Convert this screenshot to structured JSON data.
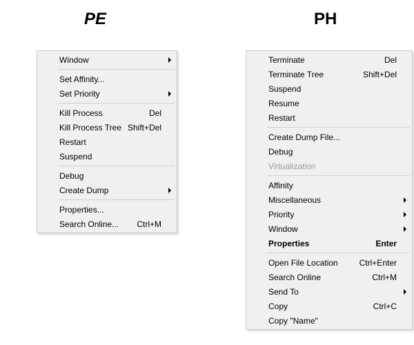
{
  "headings": {
    "pe": "PE",
    "ph": "PH"
  },
  "pe_menu": {
    "groups": [
      [
        {
          "label": "Window",
          "submenu": true
        }
      ],
      [
        {
          "label": "Set Affinity..."
        },
        {
          "label": "Set Priority",
          "submenu": true
        }
      ],
      [
        {
          "label": "Kill Process",
          "shortcut": "Del"
        },
        {
          "label": "Kill Process Tree",
          "shortcut": "Shift+Del"
        },
        {
          "label": "Restart"
        },
        {
          "label": "Suspend"
        }
      ],
      [
        {
          "label": "Debug"
        },
        {
          "label": "Create Dump",
          "submenu": true
        }
      ],
      [
        {
          "label": "Properties..."
        },
        {
          "label": "Search Online...",
          "shortcut": "Ctrl+M"
        }
      ]
    ]
  },
  "ph_menu": {
    "groups": [
      [
        {
          "label": "Terminate",
          "shortcut": "Del"
        },
        {
          "label": "Terminate Tree",
          "shortcut": "Shift+Del"
        },
        {
          "label": "Suspend"
        },
        {
          "label": "Resume"
        },
        {
          "label": "Restart"
        }
      ],
      [
        {
          "label": "Create Dump File..."
        },
        {
          "label": "Debug"
        },
        {
          "label": "Virtualization",
          "disabled": true
        }
      ],
      [
        {
          "label": "Affinity"
        },
        {
          "label": "Miscellaneous",
          "submenu": true
        },
        {
          "label": "Priority",
          "submenu": true
        },
        {
          "label": "Window",
          "submenu": true
        },
        {
          "label": "Properties",
          "shortcut": "Enter",
          "bold": true
        }
      ],
      [
        {
          "label": "Open File Location",
          "shortcut": "Ctrl+Enter"
        },
        {
          "label": "Search Online",
          "shortcut": "Ctrl+M"
        },
        {
          "label": "Send To",
          "submenu": true
        },
        {
          "label": "Copy",
          "shortcut": "Ctrl+C"
        },
        {
          "label": "Copy \"Name\""
        }
      ]
    ]
  }
}
